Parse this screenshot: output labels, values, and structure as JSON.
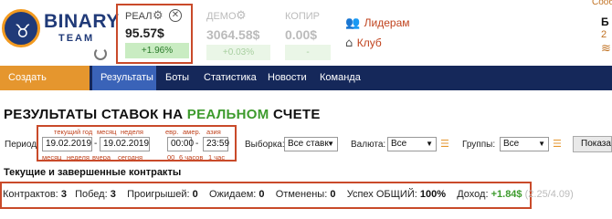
{
  "brand": {
    "name": "BINARY",
    "sub": "TEAM"
  },
  "accounts": [
    {
      "label": "РЕАЛ",
      "balance": "95.57$",
      "change": "+1.96%"
    },
    {
      "label": "ДЕМО",
      "balance": "3064.58$",
      "change": "+0.03%"
    },
    {
      "label": "КОПИР",
      "balance": "0.00$",
      "change": "-"
    }
  ],
  "side_links": {
    "leaders": "Лидерам",
    "club": "Клуб"
  },
  "corner": {
    "top": "Сооб",
    "mid": "Б",
    "num": "2"
  },
  "nav": [
    "Создать контракт",
    "Результаты",
    "Боты",
    "Статистика",
    "Новости",
    "Команда"
  ],
  "title": {
    "pre": "РЕЗУЛЬТАТЫ СТАВОК НА ",
    "hl": "РЕАЛЬНОМ",
    "post": " СЧЕТЕ"
  },
  "filters": {
    "period_label": "Период",
    "date_from": "19.02.2019",
    "date_to": "19.02.2019",
    "time_from": "00:00",
    "time_to": "23:59",
    "hints_top": [
      "текущий год",
      "месяц",
      "неделя",
      "евр.",
      "амер.",
      "азия"
    ],
    "hints_bottom": [
      "месяц",
      "неделя",
      "вчера",
      "сегодня",
      "00",
      "6 часов",
      "1 час"
    ],
    "sample_label": "Выборка:",
    "sample_value": "Все ставк",
    "currency_label": "Валюта:",
    "currency_value": "Все",
    "groups_label": "Группы:",
    "groups_value": "Все",
    "show_button": "Показат"
  },
  "section_title": "Текущие и завершенные контракты",
  "stats": {
    "contracts_label": "Контрактов:",
    "contracts": "3",
    "wins_label": "Побед:",
    "wins": "3",
    "losses_label": "Проигрышей:",
    "losses": "0",
    "pending_label": "Ожидаем:",
    "pending": "0",
    "cancelled_label": "Отменены:",
    "cancelled": "0",
    "success_label": "Успех ОБЩИЙ:",
    "success": "100%",
    "income_label": "Доход:",
    "income": "+1.84$",
    "income_detail": "(2.25/4.09)"
  },
  "colors": {
    "nav_bg": "#15285a",
    "nav_orange": "#e5962e",
    "nav_active": "#3a63b8",
    "highlight": "#c94a2a",
    "green": "#3d9b2d"
  }
}
